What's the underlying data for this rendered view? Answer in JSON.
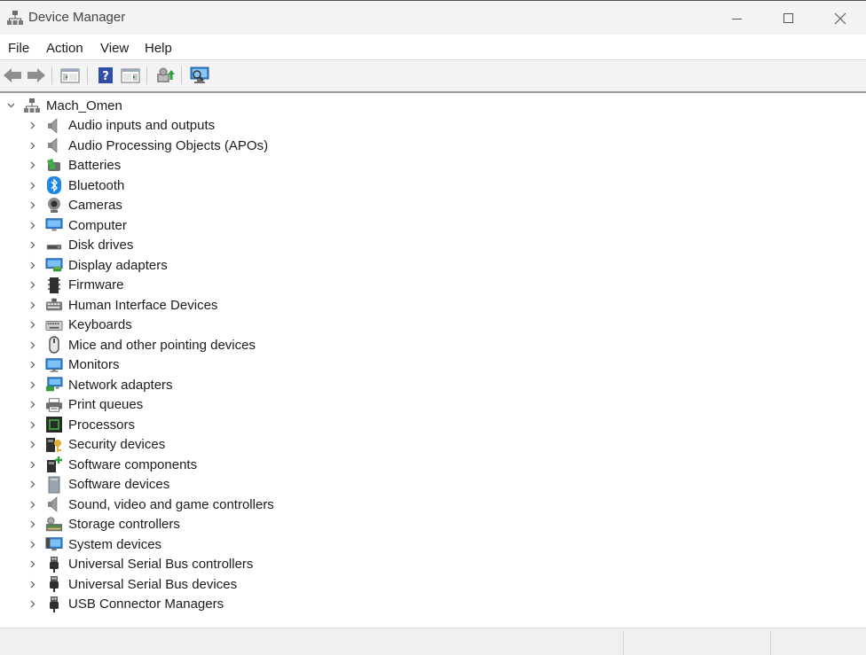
{
  "window": {
    "title": "Device Manager"
  },
  "menu": [
    "File",
    "Action",
    "View",
    "Help"
  ],
  "toolbar": {
    "buttons": [
      "back-arrow-icon",
      "forward-arrow-icon",
      "show-hide-console-tree-icon",
      "help-icon",
      "properties-icon",
      "update-driver-icon",
      "scan-hardware-changes-icon"
    ]
  },
  "tree": {
    "root": "Mach_Omen",
    "items": [
      {
        "label": "Audio inputs and outputs",
        "icon": "speaker-icon"
      },
      {
        "label": "Audio Processing Objects (APOs)",
        "icon": "speaker-icon"
      },
      {
        "label": "Batteries",
        "icon": "battery-icon"
      },
      {
        "label": "Bluetooth",
        "icon": "bluetooth-icon"
      },
      {
        "label": "Cameras",
        "icon": "camera-icon"
      },
      {
        "label": "Computer",
        "icon": "computer-icon"
      },
      {
        "label": "Disk drives",
        "icon": "disk-drive-icon"
      },
      {
        "label": "Display adapters",
        "icon": "display-adapter-icon"
      },
      {
        "label": "Firmware",
        "icon": "firmware-icon"
      },
      {
        "label": "Human Interface Devices",
        "icon": "hid-icon"
      },
      {
        "label": "Keyboards",
        "icon": "keyboard-icon"
      },
      {
        "label": "Mice and other pointing devices",
        "icon": "mouse-icon"
      },
      {
        "label": "Monitors",
        "icon": "monitor-icon"
      },
      {
        "label": "Network adapters",
        "icon": "network-adapter-icon"
      },
      {
        "label": "Print queues",
        "icon": "printer-icon"
      },
      {
        "label": "Processors",
        "icon": "processor-icon"
      },
      {
        "label": "Security devices",
        "icon": "security-device-icon"
      },
      {
        "label": "Software components",
        "icon": "software-component-icon"
      },
      {
        "label": "Software devices",
        "icon": "software-device-icon"
      },
      {
        "label": "Sound, video and game controllers",
        "icon": "speaker-icon"
      },
      {
        "label": "Storage controllers",
        "icon": "storage-controller-icon"
      },
      {
        "label": "System devices",
        "icon": "system-device-icon"
      },
      {
        "label": "Universal Serial Bus controllers",
        "icon": "usb-icon"
      },
      {
        "label": "Universal Serial Bus devices",
        "icon": "usb-icon"
      },
      {
        "label": "USB Connector Managers",
        "icon": "usb-icon"
      }
    ]
  }
}
